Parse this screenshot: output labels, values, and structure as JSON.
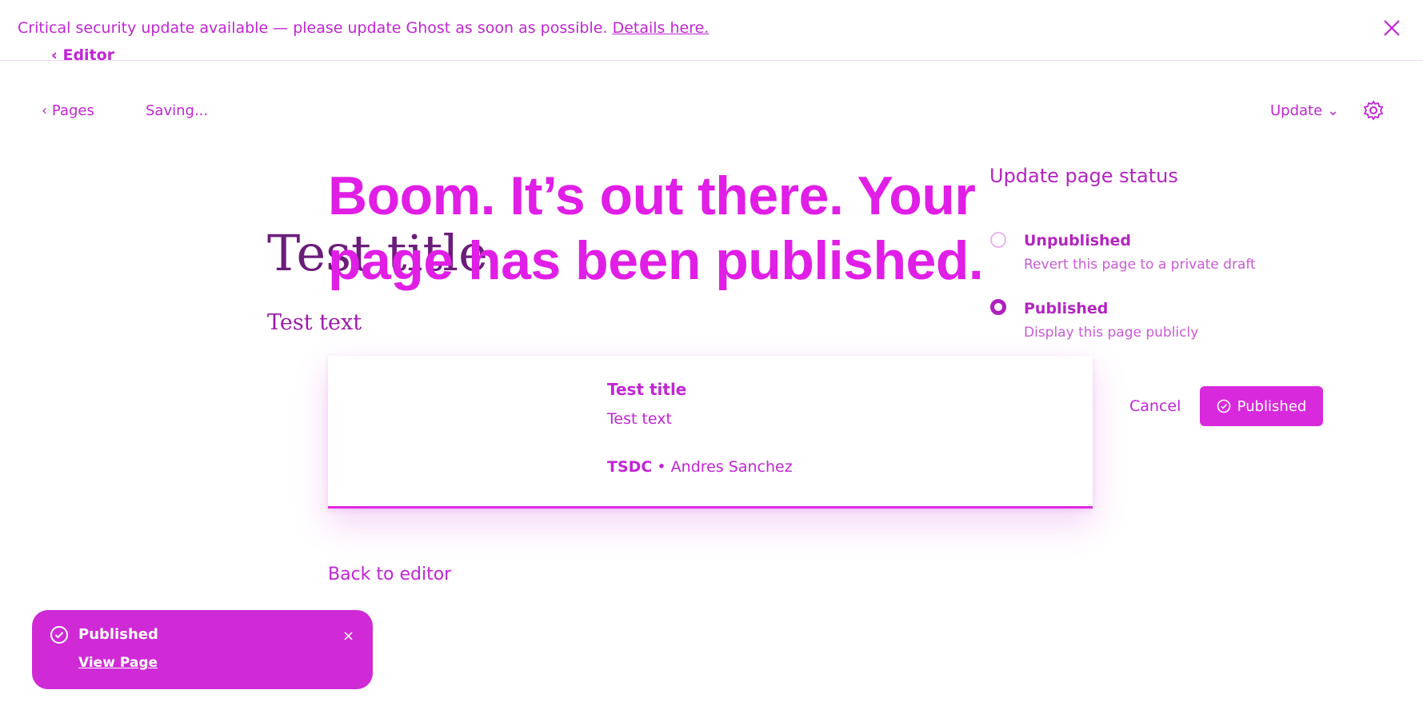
{
  "banner": {
    "text": "Critical security update available — please update Ghost as soon as possible.",
    "link_label": "Details here.",
    "close_icon": "close-icon"
  },
  "nav": {
    "editor_back_label": "Editor",
    "pages_label": "Pages",
    "saving_label": "Saving...",
    "update_label": "Update",
    "settings_icon": "gear-icon"
  },
  "post": {
    "title": "Test title",
    "text": "Test text"
  },
  "modal": {
    "headline": "Boom. It’s out there. Your page has been published.",
    "card": {
      "title": "Test title",
      "excerpt": "Test text",
      "site": "TSDC",
      "author": "Andres Sanchez"
    },
    "back_label": "Back to editor"
  },
  "status_panel": {
    "heading": "Update page status",
    "options": [
      {
        "label": "Unpublished",
        "description": "Revert this page to a private draft",
        "selected": false
      },
      {
        "label": "Published",
        "description": "Display this page publicly",
        "selected": true
      }
    ],
    "cancel_label": "Cancel",
    "confirm_label": "Published"
  },
  "toast": {
    "title": "Published",
    "link_label": "View Page",
    "close_label": "×"
  },
  "colors": {
    "accent": "#c026d3",
    "button": "#d82adc",
    "headline": "#e01ee6"
  }
}
